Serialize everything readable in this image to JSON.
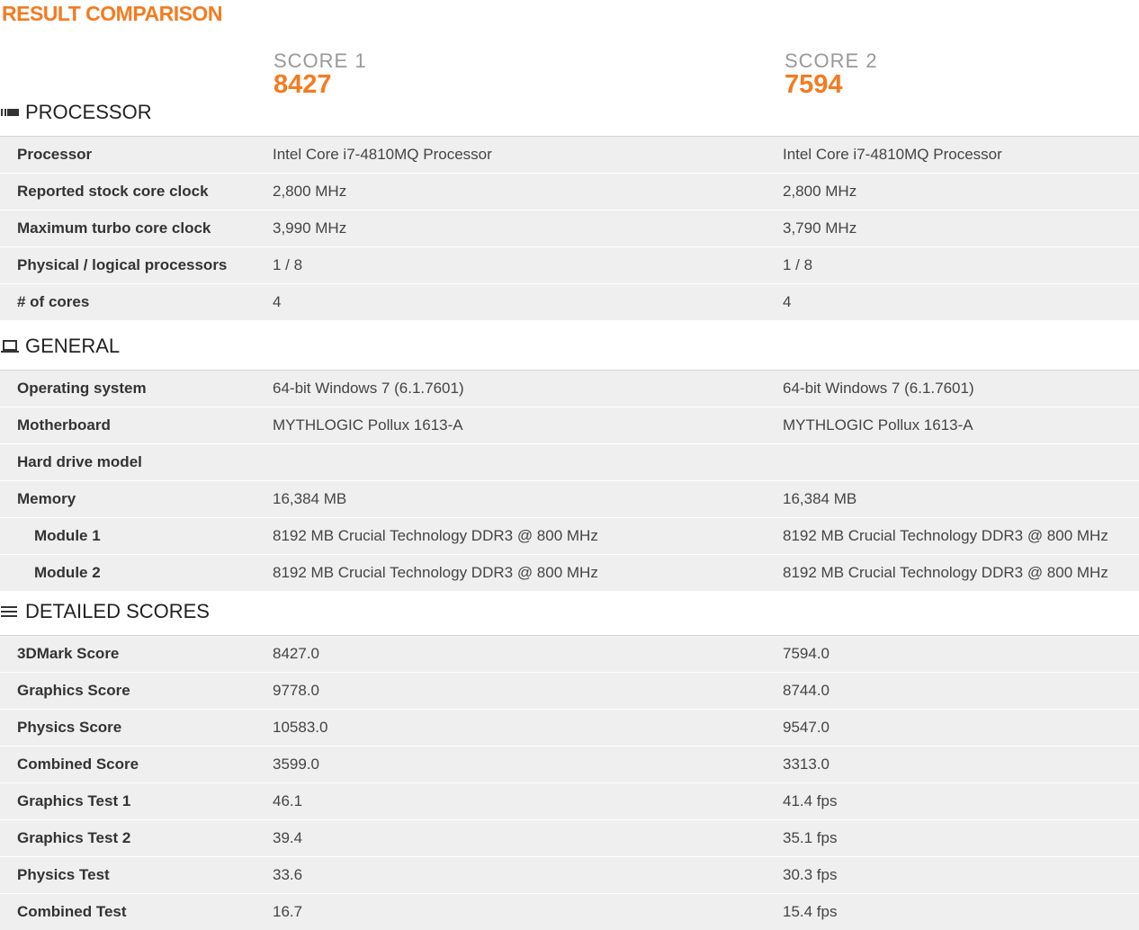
{
  "title": "RESULT COMPARISON",
  "scores": [
    {
      "label": "SCORE 1",
      "value": "8427"
    },
    {
      "label": "SCORE 2",
      "value": "7594"
    }
  ],
  "sections": {
    "processor": {
      "title": "PROCESSOR",
      "icon": "cpu-icon",
      "rows": [
        {
          "label": "Processor",
          "v1": "Intel Core i7-4810MQ Processor",
          "v2": "Intel Core i7-4810MQ Processor"
        },
        {
          "label": "Reported stock core clock",
          "v1": "2,800 MHz",
          "v2": "2,800 MHz"
        },
        {
          "label": "Maximum turbo core clock",
          "v1": "3,990 MHz",
          "v2": "3,790 MHz"
        },
        {
          "label": "Physical / logical processors",
          "v1": "1 / 8",
          "v2": "1 / 8"
        },
        {
          "label": "# of cores",
          "v1": "4",
          "v2": "4"
        }
      ]
    },
    "general": {
      "title": "GENERAL",
      "icon": "laptop-icon",
      "rows": [
        {
          "label": "Operating system",
          "v1": "64-bit Windows 7 (6.1.7601)",
          "v2": "64-bit Windows 7 (6.1.7601)"
        },
        {
          "label": "Motherboard",
          "v1": "MYTHLOGIC Pollux 1613-A",
          "v2": "MYTHLOGIC Pollux 1613-A"
        },
        {
          "label": "Hard drive model",
          "v1": "",
          "v2": ""
        },
        {
          "label": "Memory",
          "v1": "16,384 MB",
          "v2": "16,384 MB"
        },
        {
          "label": "Module 1",
          "v1": "8192 MB Crucial Technology DDR3 @ 800 MHz",
          "v2": "8192 MB Crucial Technology DDR3 @ 800 MHz"
        },
        {
          "label": "Module 2",
          "v1": "8192 MB Crucial Technology DDR3 @ 800 MHz",
          "v2": "8192 MB Crucial Technology DDR3 @ 800 MHz"
        }
      ]
    },
    "detailed": {
      "title": "DETAILED SCORES",
      "icon": "list-icon",
      "rows": [
        {
          "label": "3DMark Score",
          "v1": "8427.0",
          "v2": "7594.0"
        },
        {
          "label": "Graphics Score",
          "v1": "9778.0",
          "v2": "8744.0"
        },
        {
          "label": "Physics Score",
          "v1": "10583.0",
          "v2": "9547.0"
        },
        {
          "label": "Combined Score",
          "v1": "3599.0",
          "v2": "3313.0"
        },
        {
          "label": "Graphics Test 1",
          "v1": "46.1",
          "v2": "41.4 fps"
        },
        {
          "label": "Graphics Test 2",
          "v1": "39.4",
          "v2": "35.1 fps"
        },
        {
          "label": "Physics Test",
          "v1": "33.6",
          "v2": "30.3 fps"
        },
        {
          "label": "Combined Test",
          "v1": "16.7",
          "v2": "15.4 fps"
        }
      ]
    }
  },
  "colors": {
    "accent": "#f47b20",
    "row_bg": "#efefef"
  }
}
